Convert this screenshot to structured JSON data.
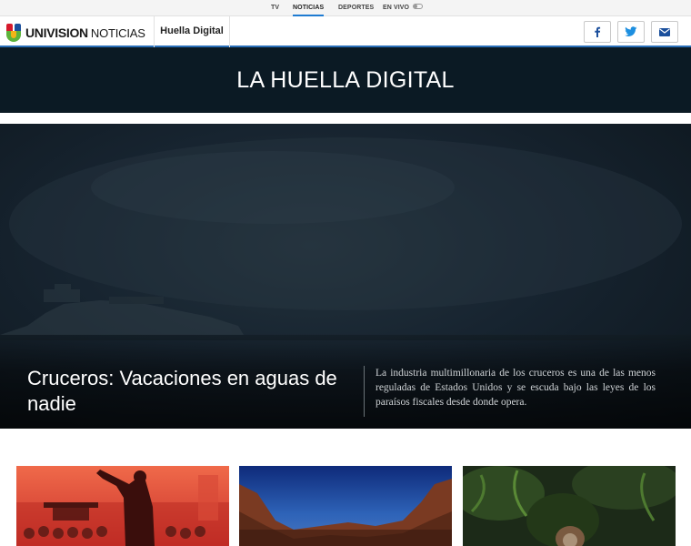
{
  "topnav": {
    "items": [
      {
        "label": "TV",
        "active": false
      },
      {
        "label": "NOTICIAS",
        "active": true
      },
      {
        "label": "DEPORTES",
        "active": false
      },
      {
        "label": "EN VIVO",
        "active": false
      }
    ]
  },
  "header": {
    "logo_word": "UNIVISION",
    "logo_section": "NOTICIAS",
    "section_title": "Huella Digital",
    "share": {
      "facebook_icon": "facebook-icon",
      "twitter_icon": "twitter-icon",
      "email_icon": "email-icon"
    }
  },
  "banner": {
    "title": "LA HUELLA DIGITAL"
  },
  "hero": {
    "title": "Cruceros: Vacaciones en aguas de nadie",
    "description": "La industria multimillonaria de los cruceros es una de las menos reguladas de Estados Unidos y se escuda bajo las leyes de los paraísos fiscales desde donde opera."
  },
  "colors": {
    "accent": "#2a6fb8",
    "banner_bg": "#0b1a24",
    "logo_red": "#d6192b",
    "logo_blue": "#1b4f9c",
    "logo_green": "#5db33b",
    "logo_yellow": "#f2b417"
  }
}
